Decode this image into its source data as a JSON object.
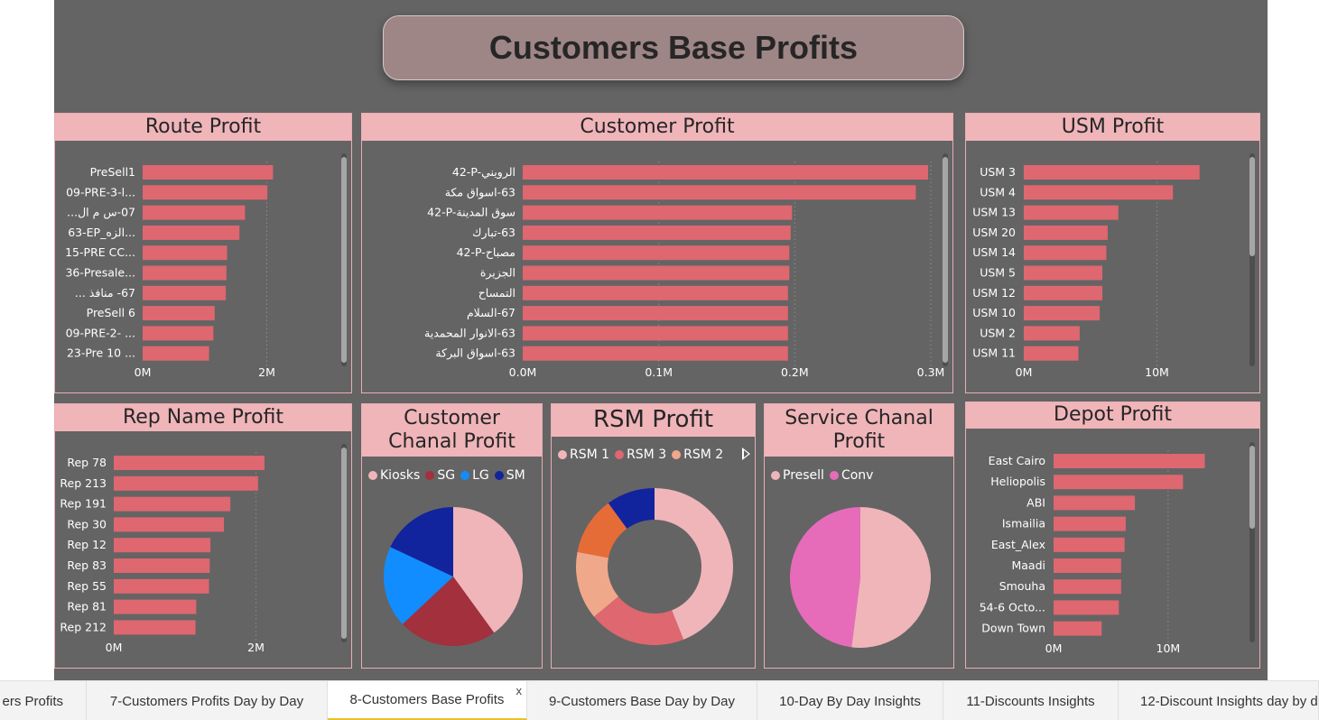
{
  "page": {
    "title": "Customers Base Profits"
  },
  "colors": {
    "bar": "#de6770",
    "header_bg": "#f0b5b9",
    "canvas": "#646464",
    "axis_text": "#ffffff",
    "active_tab_underline": "#e8c32a"
  },
  "panels": {
    "route": {
      "title": "Route Profit"
    },
    "customer": {
      "title": "Customer Profit"
    },
    "usm": {
      "title": "USM Profit"
    },
    "rep": {
      "title": "Rep Name Profit"
    },
    "channel": {
      "title": "Customer Chanal Profit"
    },
    "rsm": {
      "title": "RSM Profit"
    },
    "service": {
      "title": "Service Chanal Profit"
    },
    "depot": {
      "title": "Depot Profit"
    }
  },
  "chart_data": [
    {
      "id": "route",
      "type": "bar",
      "orientation": "horizontal",
      "categories": [
        "PreSell1",
        "09-PRE-3-l...",
        "07-س م ال...",
        "63-EP_الزه...",
        "15-PRE CC...",
        "36-Presale...",
        "67- منافذ ...",
        "PreSell 6",
        "09-PRE-2- ...",
        "23-Pre 10 ..."
      ],
      "values": [
        2.1,
        2.01,
        1.65,
        1.56,
        1.36,
        1.35,
        1.34,
        1.16,
        1.14,
        1.07
      ],
      "unit": "M",
      "ticks": [
        {
          "v": 0,
          "label": "0M"
        },
        {
          "v": 2,
          "label": "2M"
        }
      ],
      "xlim": [
        0,
        3.2
      ],
      "grid": true
    },
    {
      "id": "customer",
      "type": "bar",
      "orientation": "horizontal",
      "categories": [
        "42-P-الرويني",
        "63-اسواق مكة",
        "42-P-سوق المدينة",
        "63-تبارك",
        "42-P-مصباح",
        "الجزيرة",
        "التمساح",
        "67-السلام",
        "63-الانوار المحمدية",
        "63-اسواق البركة"
      ],
      "values": [
        0.298,
        0.289,
        0.198,
        0.197,
        0.196,
        0.196,
        0.195,
        0.195,
        0.195,
        0.195
      ],
      "unit": "M",
      "ticks": [
        {
          "v": 0,
          "label": "0.0M"
        },
        {
          "v": 0.1,
          "label": "0.1M"
        },
        {
          "v": 0.2,
          "label": "0.2M"
        },
        {
          "v": 0.3,
          "label": "0.3M"
        }
      ],
      "xlim": [
        0,
        0.3
      ],
      "grid": true
    },
    {
      "id": "usm",
      "type": "bar",
      "orientation": "horizontal",
      "categories": [
        "USM 3",
        "USM 4",
        "USM 13",
        "USM 20",
        "USM 14",
        "USM 5",
        "USM 12",
        "USM 10",
        "USM 2",
        "USM 11"
      ],
      "values": [
        13.2,
        11.2,
        7.1,
        6.3,
        6.2,
        5.9,
        5.9,
        5.7,
        4.2,
        4.1
      ],
      "unit": "M",
      "ticks": [
        {
          "v": 0,
          "label": "0M"
        },
        {
          "v": 10,
          "label": "10M"
        }
      ],
      "xlim": [
        0,
        16
      ],
      "grid": true
    },
    {
      "id": "rep",
      "type": "bar",
      "orientation": "horizontal",
      "categories": [
        "Rep 78",
        "Rep 213",
        "Rep 191",
        "Rep 30",
        "Rep 12",
        "Rep 83",
        "Rep 55",
        "Rep 81",
        "Rep 212"
      ],
      "values": [
        2.12,
        2.03,
        1.64,
        1.55,
        1.36,
        1.35,
        1.34,
        1.16,
        1.15
      ],
      "unit": "M",
      "ticks": [
        {
          "v": 0,
          "label": "0M"
        },
        {
          "v": 2,
          "label": "2M"
        }
      ],
      "xlim": [
        0,
        3.2
      ],
      "grid": true
    },
    {
      "id": "depot",
      "type": "bar",
      "orientation": "horizontal",
      "categories": [
        "East Cairo",
        "Heliopolis",
        "ABI",
        "Ismailia",
        "East_Alex",
        "Maadi",
        "Smouha",
        "54-6 Octo...",
        "Down Town"
      ],
      "values": [
        13.2,
        11.3,
        7.1,
        6.3,
        6.2,
        5.9,
        5.9,
        5.7,
        4.2
      ],
      "unit": "M",
      "ticks": [
        {
          "v": 0,
          "label": "0M"
        },
        {
          "v": 10,
          "label": "10M"
        }
      ],
      "xlim": [
        0,
        16
      ],
      "grid": true
    },
    {
      "id": "channel",
      "type": "pie",
      "labels": [
        "Kiosks",
        "SG",
        "LG",
        "SM"
      ],
      "values": [
        40,
        23,
        19,
        18
      ],
      "colors": [
        "#f0b5b9",
        "#a2303d",
        "#118dff",
        "#12239e"
      ],
      "legend": "top-left"
    },
    {
      "id": "rsm",
      "type": "pie",
      "donut": true,
      "labels": [
        "RSM 1",
        "RSM 3",
        "RSM 2",
        "",
        ""
      ],
      "values": [
        44,
        20,
        14,
        12,
        10
      ],
      "colors": [
        "#f0b5b9",
        "#de6770",
        "#f0a88a",
        "#e66c37",
        "#12239e"
      ],
      "legend": "top-left"
    },
    {
      "id": "service",
      "type": "pie",
      "labels": [
        "Presell",
        "Conv"
      ],
      "values": [
        52,
        48
      ],
      "colors": [
        "#f0b5b9",
        "#e66cb9"
      ],
      "legend": "top-left"
    }
  ],
  "tabs": [
    {
      "label": "ers Profits"
    },
    {
      "label": "7-Customers Profits Day by Day"
    },
    {
      "label": "8-Customers Base Profits",
      "close": "x"
    },
    {
      "label": "9-Customers Base Day by Day"
    },
    {
      "label": "10-Day By Day Insights"
    },
    {
      "label": "11-Discounts Insights"
    },
    {
      "label": "12-Discount Insights day by d"
    }
  ]
}
